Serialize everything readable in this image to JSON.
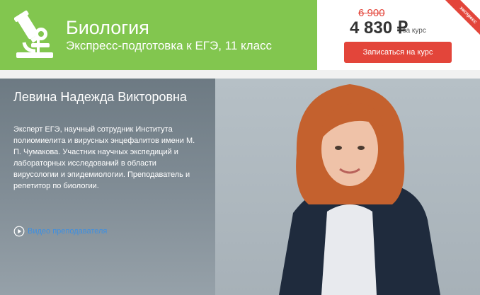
{
  "header": {
    "subject_title": "Биология",
    "subject_subtitle": "Экспресс-подготовка к ЕГЭ, 11 класс",
    "icon": "microscope-icon",
    "color": "#82c64f"
  },
  "pricing": {
    "old_price": "6 900",
    "new_price": "4 830 ₽",
    "price_suffix": "за курс",
    "enroll_label": "Записаться на курс",
    "ribbon_label": "экспресс",
    "accent_color": "#e3453a"
  },
  "teacher": {
    "name": "Левина Надежда Викторовна",
    "bio": "Эксперт ЕГЭ, научный сотрудник Института полиомиелита и вирусных энцефалитов имени М. П. Чумакова. Участник научных экспедиций и лабораторных исследований в области вирусологии и эпидемиологии. Преподаватель и репетитор по биологии.",
    "video_link_label": "Видео преподавателя",
    "video_icon": "play-circle-icon"
  }
}
